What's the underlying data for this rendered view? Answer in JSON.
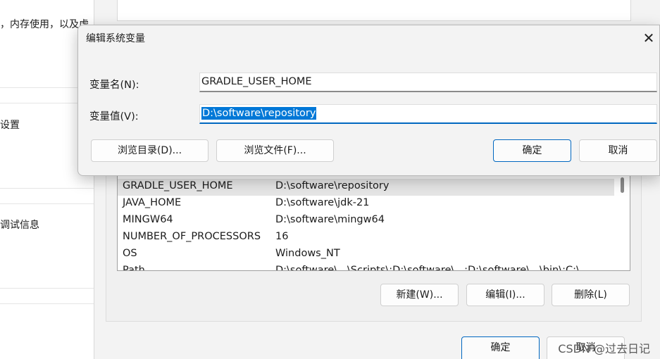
{
  "left_pane": {
    "texts": [
      "，内存使用，以及虚",
      "设置",
      "调试信息"
    ]
  },
  "edit_dialog": {
    "title": "编辑系统变量",
    "close_glyph": "✕",
    "name_label": "变量名(N):",
    "name_value": "GRADLE_USER_HOME",
    "value_label": "变量值(V):",
    "value_value": "D:\\software\\repository",
    "browse_dir_button": "浏览目录(D)...",
    "browse_file_button": "浏览文件(F)...",
    "ok_button": "确定",
    "cancel_button": "取消"
  },
  "system_variables": {
    "rows": [
      {
        "name": "GRADLE_USER_HOME",
        "value": "D:\\software\\repository",
        "selected": true
      },
      {
        "name": "JAVA_HOME",
        "value": "D:\\software\\jdk-21",
        "selected": false
      },
      {
        "name": "MINGW64",
        "value": "D:\\software\\mingw64",
        "selected": false
      },
      {
        "name": "NUMBER_OF_PROCESSORS",
        "value": "16",
        "selected": false
      },
      {
        "name": "OS",
        "value": "Windows_NT",
        "selected": false
      },
      {
        "name": "Path",
        "value": "D:\\software\\...\\Scripts\\;D:\\software\\...;D:\\software\\...\\bin\\;C:\\",
        "selected": false
      }
    ],
    "new_button": "新建(W)...",
    "edit_button": "编辑(I)...",
    "delete_button": "删除(L)"
  },
  "env_window": {
    "ok_button": "确定",
    "cancel_button": "取消"
  },
  "watermark": "CSDN @过去日记",
  "colors": {
    "accent": "#0067c0",
    "selection": "#0078d7"
  }
}
